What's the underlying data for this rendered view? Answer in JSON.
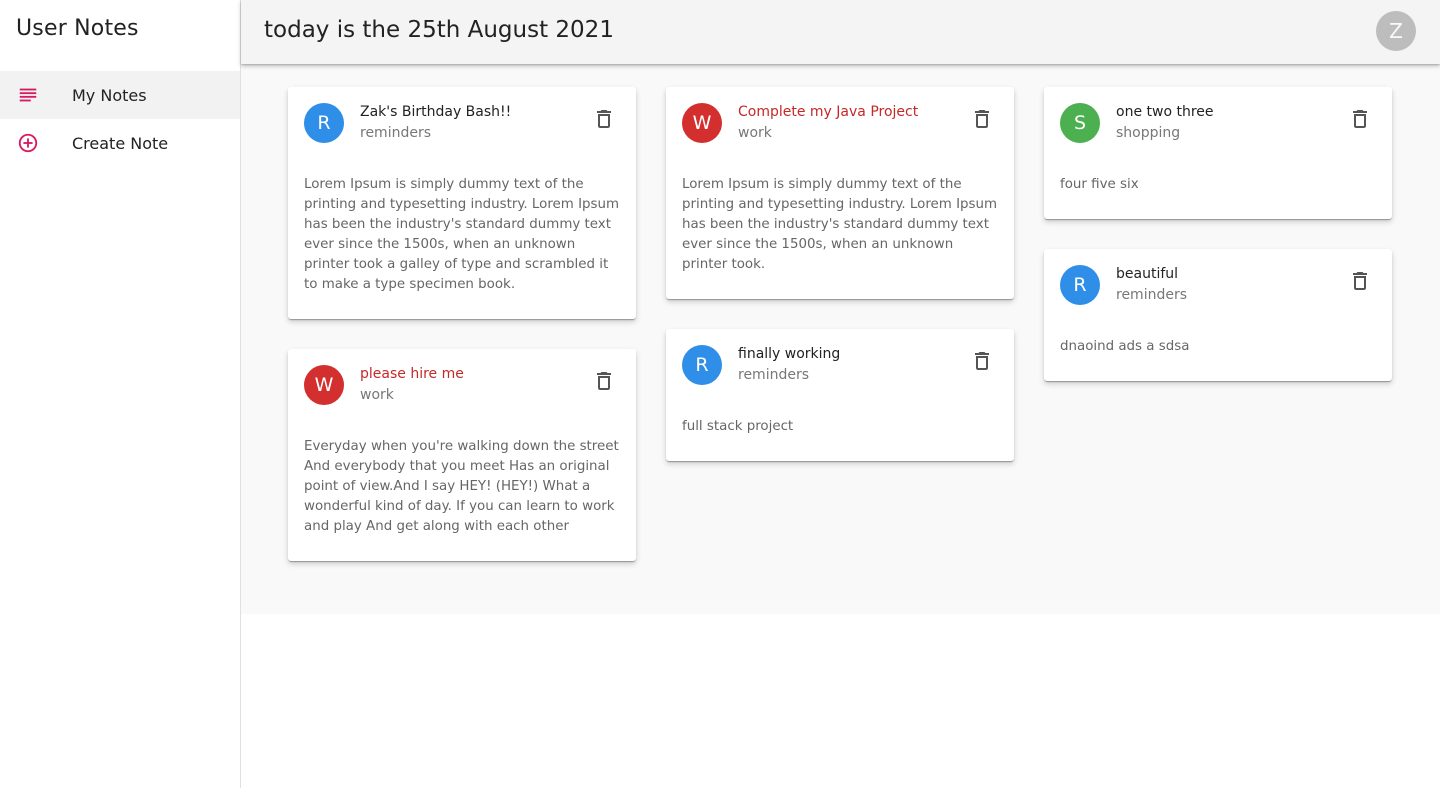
{
  "sidebar": {
    "title": "User Notes",
    "items": [
      {
        "label": "My Notes",
        "icon": "notes-list-icon"
      },
      {
        "label": "Create Note",
        "icon": "add-circle-icon"
      }
    ]
  },
  "header": {
    "title": "today is the 25th August 2021",
    "user_initial": "Z"
  },
  "colors": {
    "reminders": "#2f8ee8",
    "work": "#d32f2f",
    "shopping": "#4caf50",
    "nav_icon": "#d81b60"
  },
  "notes": [
    {
      "initial": "R",
      "title": "Zak's Birthday Bash!!",
      "category": "reminders",
      "body": "Lorem Ipsum is simply dummy text of the printing and typesetting industry. Lorem Ipsum has been the industry's standard dummy text ever since the 1500s, when an unknown printer took a galley of type and scrambled it to make a type specimen book."
    },
    {
      "initial": "W",
      "title": "please hire me",
      "category": "work",
      "body": "Everyday when you're walking down the street And everybody that you meet Has an original point of view.And I say HEY! (HEY!) What a wonderful kind of day. If you can learn to work and play And get along with each other"
    },
    {
      "initial": "W",
      "title": "Complete my Java Project",
      "category": "work",
      "body": "Lorem Ipsum is simply dummy text of the printing and typesetting industry. Lorem Ipsum has been the industry's standard dummy text ever since the 1500s, when an unknown printer took."
    },
    {
      "initial": "R",
      "title": "finally working",
      "category": "reminders",
      "body": "full stack project"
    },
    {
      "initial": "S",
      "title": "one two three",
      "category": "shopping",
      "body": "four five six"
    },
    {
      "initial": "R",
      "title": "beautiful",
      "category": "reminders",
      "body": "dnaoind ads a sdsa"
    }
  ]
}
